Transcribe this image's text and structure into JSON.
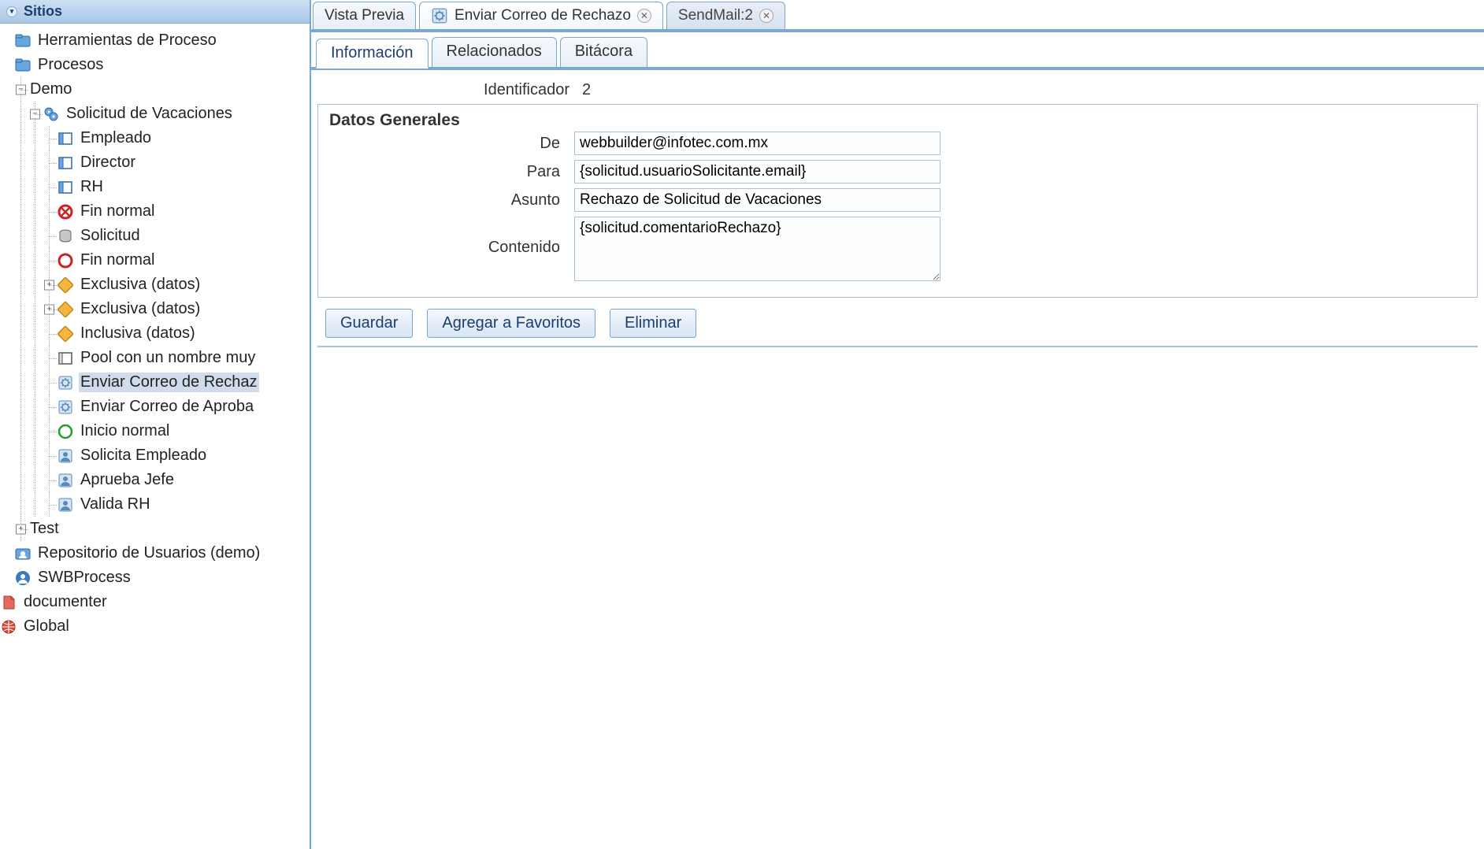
{
  "sidebar": {
    "title": "Sitios",
    "nodes": {
      "herramientas": "Herramientas de Proceso",
      "procesos": "Procesos",
      "demo": "Demo",
      "solicitud_vac": "Solicitud de Vacaciones",
      "empleado": "Empleado",
      "director": "Director",
      "rh": "RH",
      "fin_normal_1": "Fin normal",
      "solicitud": "Solicitud",
      "fin_normal_2": "Fin normal",
      "exclusiva_1": "Exclusiva (datos)",
      "exclusiva_2": "Exclusiva (datos)",
      "inclusiva": "Inclusiva (datos)",
      "pool": "Pool con un nombre muy",
      "enviar_rechazo": "Enviar Correo de Rechaz",
      "enviar_aproba": "Enviar Correo de Aproba",
      "inicio_normal": "Inicio normal",
      "solicita_empleado": "Solicita Empleado",
      "aprueba_jefe": "Aprueba Jefe",
      "valida_rh": "Valida RH",
      "test": "Test",
      "repo_usuarios": "Repositorio de Usuarios (demo)",
      "swbprocess": "SWBProcess",
      "documenter": "documenter",
      "global": "Global"
    }
  },
  "tabs": {
    "vista_previa": "Vista Previa",
    "enviar_correo": "Enviar Correo de Rechazo",
    "sendmail": "SendMail:2"
  },
  "subtabs": {
    "informacion": "Información",
    "relacionados": "Relacionados",
    "bitacora": "Bitácora"
  },
  "form": {
    "identificador_label": "Identificador",
    "identificador_value": "2",
    "legend": "Datos Generales",
    "de_label": "De",
    "de_value": "webbuilder@infotec.com.mx",
    "para_label": "Para",
    "para_value": "{solicitud.usuarioSolicitante.email}",
    "asunto_label": "Asunto",
    "asunto_value": "Rechazo de Solicitud de Vacaciones",
    "contenido_label": "Contenido",
    "contenido_value": "{solicitud.comentarioRechazo}"
  },
  "buttons": {
    "guardar": "Guardar",
    "favoritos": "Agregar a Favoritos",
    "eliminar": "Eliminar"
  }
}
